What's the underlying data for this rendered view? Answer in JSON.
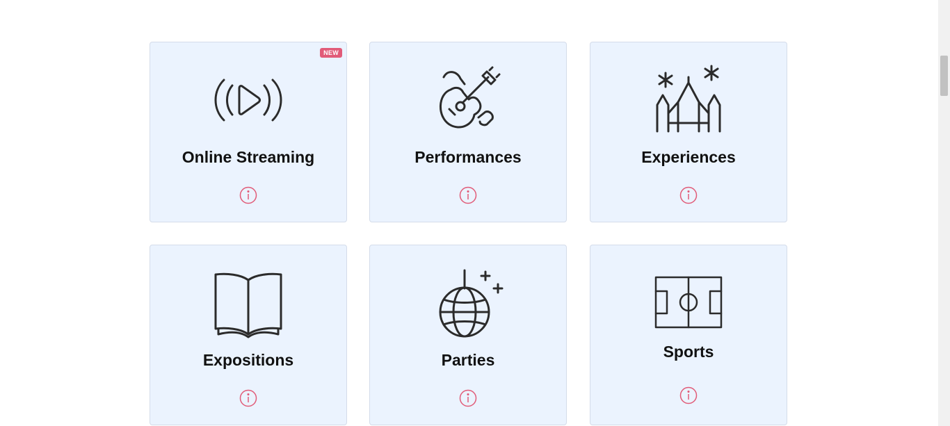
{
  "categories": [
    {
      "label": "Online Streaming",
      "icon": "streaming-icon",
      "badge": "NEW"
    },
    {
      "label": "Performances",
      "icon": "guitar-icon",
      "badge": ""
    },
    {
      "label": "Experiences",
      "icon": "castle-fireworks-icon",
      "badge": ""
    },
    {
      "label": "Expositions",
      "icon": "open-book-icon",
      "badge": ""
    },
    {
      "label": "Parties",
      "icon": "disco-ball-icon",
      "badge": ""
    },
    {
      "label": "Sports",
      "icon": "soccer-field-icon",
      "badge": ""
    }
  ],
  "colors": {
    "card_bg": "#ebf3fe",
    "accent": "#e15b78",
    "icon_stroke": "#2b2b2b"
  }
}
